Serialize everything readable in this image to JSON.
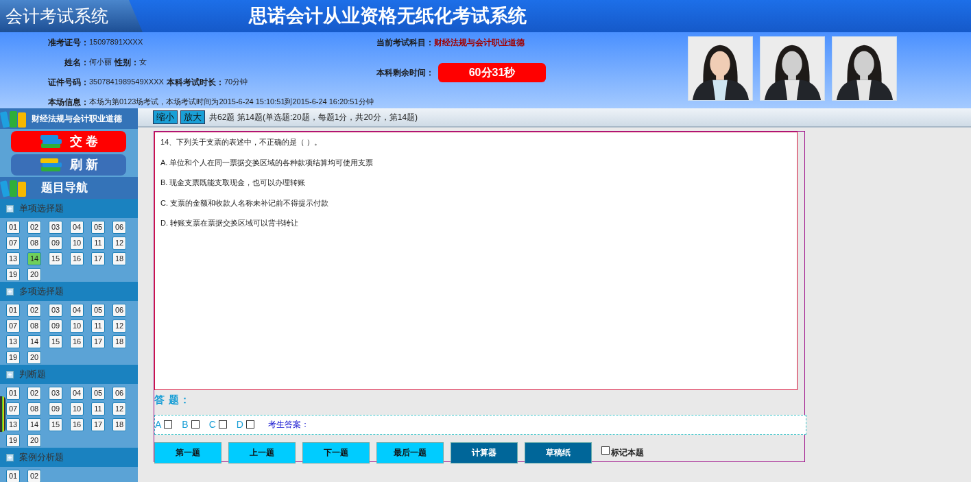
{
  "header": {
    "logo": "会计考试系统",
    "title": "思诺会计从业资格无纸化考试系统"
  },
  "candidate": {
    "exam_number": {
      "label": "准考证号：",
      "value": "15097891XXXX"
    },
    "name": {
      "label": "姓名：",
      "value": "何小丽"
    },
    "gender": {
      "label": "性别：",
      "value": "女"
    },
    "id_number": {
      "label": "证件号码：",
      "value": "3507841989549XXXX"
    },
    "duration": {
      "label": "本科考试时长：",
      "value": "70分钟"
    },
    "session": {
      "label": "本场信息：",
      "value": "本场为第0123场考试，本场考试时间为2015-6-24 15:10:51到2015-6-24 16:20:51分钟"
    }
  },
  "subject": {
    "label": "当前考试科目：",
    "value": "财经法规与会计职业道德"
  },
  "timer": {
    "label": "本科剩余时间：",
    "value": "60分31秒"
  },
  "photos": [
    {
      "kind": "picture",
      "grayscale": false
    },
    {
      "kind": "picture",
      "grayscale": true
    },
    {
      "kind": "picture",
      "grayscale": true
    }
  ],
  "sidebar": {
    "subject": "财经法规与会计职业道德",
    "submit": "交 卷",
    "refresh": "刷 新",
    "nav_title": "题目导航",
    "sections": [
      {
        "title": "单项选择题",
        "questions": [
          {
            "number": "01",
            "selected": false
          },
          {
            "number": "02",
            "selected": false
          },
          {
            "number": "03",
            "selected": false
          },
          {
            "number": "04",
            "selected": false
          },
          {
            "number": "05",
            "selected": false
          },
          {
            "number": "06",
            "selected": false
          },
          {
            "number": "07",
            "selected": false
          },
          {
            "number": "08",
            "selected": false
          },
          {
            "number": "09",
            "selected": false
          },
          {
            "number": "10",
            "selected": false
          },
          {
            "number": "11",
            "selected": false
          },
          {
            "number": "12",
            "selected": false
          },
          {
            "number": "13",
            "selected": false
          },
          {
            "number": "14",
            "selected": true
          },
          {
            "number": "15",
            "selected": false
          },
          {
            "number": "16",
            "selected": false
          },
          {
            "number": "17",
            "selected": false
          },
          {
            "number": "18",
            "selected": false
          },
          {
            "number": "19",
            "selected": false
          },
          {
            "number": "20",
            "selected": false
          }
        ]
      },
      {
        "title": "多项选择题",
        "questions": [
          {
            "number": "01",
            "selected": false
          },
          {
            "number": "02",
            "selected": false
          },
          {
            "number": "03",
            "selected": false
          },
          {
            "number": "04",
            "selected": false
          },
          {
            "number": "05",
            "selected": false
          },
          {
            "number": "06",
            "selected": false
          },
          {
            "number": "07",
            "selected": false
          },
          {
            "number": "08",
            "selected": false
          },
          {
            "number": "09",
            "selected": false
          },
          {
            "number": "10",
            "selected": false
          },
          {
            "number": "11",
            "selected": false
          },
          {
            "number": "12",
            "selected": false
          },
          {
            "number": "13",
            "selected": false
          },
          {
            "number": "14",
            "selected": false
          },
          {
            "number": "15",
            "selected": false
          },
          {
            "number": "16",
            "selected": false
          },
          {
            "number": "17",
            "selected": false
          },
          {
            "number": "18",
            "selected": false
          },
          {
            "number": "19",
            "selected": false
          },
          {
            "number": "20",
            "selected": false
          }
        ]
      },
      {
        "title": "判断题",
        "questions": [
          {
            "number": "01",
            "selected": false
          },
          {
            "number": "02",
            "selected": false
          },
          {
            "number": "03",
            "selected": false
          },
          {
            "number": "04",
            "selected": false
          },
          {
            "number": "05",
            "selected": false
          },
          {
            "number": "06",
            "selected": false
          },
          {
            "number": "07",
            "selected": false
          },
          {
            "number": "08",
            "selected": false
          },
          {
            "number": "09",
            "selected": false
          },
          {
            "number": "10",
            "selected": false
          },
          {
            "number": "11",
            "selected": false
          },
          {
            "number": "12",
            "selected": false
          },
          {
            "number": "13",
            "selected": false
          },
          {
            "number": "14",
            "selected": false
          },
          {
            "number": "15",
            "selected": false
          },
          {
            "number": "16",
            "selected": false
          },
          {
            "number": "17",
            "selected": false
          },
          {
            "number": "18",
            "selected": false
          },
          {
            "number": "19",
            "selected": false
          },
          {
            "number": "20",
            "selected": false
          }
        ]
      },
      {
        "title": "案例分析题",
        "questions": [
          {
            "number": "01",
            "selected": false
          },
          {
            "number": "02",
            "selected": false
          }
        ]
      }
    ]
  },
  "toolbar": {
    "zoom_out": "缩小",
    "zoom_in": "放大",
    "summary": "共62题 第14题(单选题:20题，每题1分，共20分，第14题)"
  },
  "question": {
    "stem": "14、下列关于支票的表述中，不正确的是（  ）。",
    "options": [
      "A. 单位和个人在同一票据交换区域的各种款项结算均可使用支票",
      "B. 现金支票既能支取现金，也可以办理转账",
      "C. 支票的金额和收款人名称未补记前不得提示付款",
      "D. 转账支票在票据交换区域可以背书转让"
    ]
  },
  "answer": {
    "label": "答 题：",
    "choices": [
      {
        "letter": "A",
        "checked": false
      },
      {
        "letter": "B",
        "checked": false
      },
      {
        "letter": "C",
        "checked": false
      },
      {
        "letter": "D",
        "checked": false
      }
    ],
    "candidate_answer_label": "考生答案："
  },
  "buttons": [
    {
      "label": "第一题",
      "kind": "nav"
    },
    {
      "label": "上一题",
      "kind": "nav"
    },
    {
      "label": "下一题",
      "kind": "nav"
    },
    {
      "label": "最后一题",
      "kind": "nav"
    },
    {
      "label": "计算器",
      "kind": "tool"
    },
    {
      "label": "草稿纸",
      "kind": "tool"
    }
  ],
  "mark": {
    "label": "标记本题",
    "checked": false
  }
}
